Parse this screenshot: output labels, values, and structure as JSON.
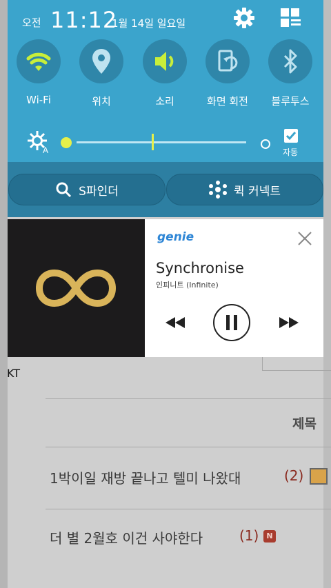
{
  "status_bar": {
    "ampm": "오전",
    "time": "11:12",
    "date": "1월 14일 일요일"
  },
  "quick_settings": [
    {
      "label": "Wi-Fi",
      "icon": "wifi-icon",
      "active": true
    },
    {
      "label": "위치",
      "icon": "location-icon",
      "active": false
    },
    {
      "label": "소리",
      "icon": "sound-icon",
      "active": true
    },
    {
      "label": "화면 회전",
      "icon": "rotate-icon",
      "active": false
    },
    {
      "label": "블루투스",
      "icon": "bluetooth-icon",
      "active": false
    }
  ],
  "brightness": {
    "auto_label": "자동",
    "auto_checked": true,
    "level": 0.0
  },
  "pills": {
    "s_finder": "S파인더",
    "quick_connect": "퀵 커넥트"
  },
  "music": {
    "app": "genie",
    "title": "Synchronise",
    "artist": "인피니트 (Infinite)"
  },
  "background_page": {
    "carrier": "KT",
    "column_header": "제목",
    "rows": [
      {
        "title": "1박이일 재방 끝나고 텔미 나왔대",
        "count": "(2)"
      },
      {
        "title": "더 별 2월호 이건 사야한다",
        "count": "(1)",
        "badge": "N"
      }
    ]
  },
  "colors": {
    "panel": "#3ba4cc",
    "active_icon": "#c8ee3a",
    "genie_blue": "#2e86d6"
  }
}
